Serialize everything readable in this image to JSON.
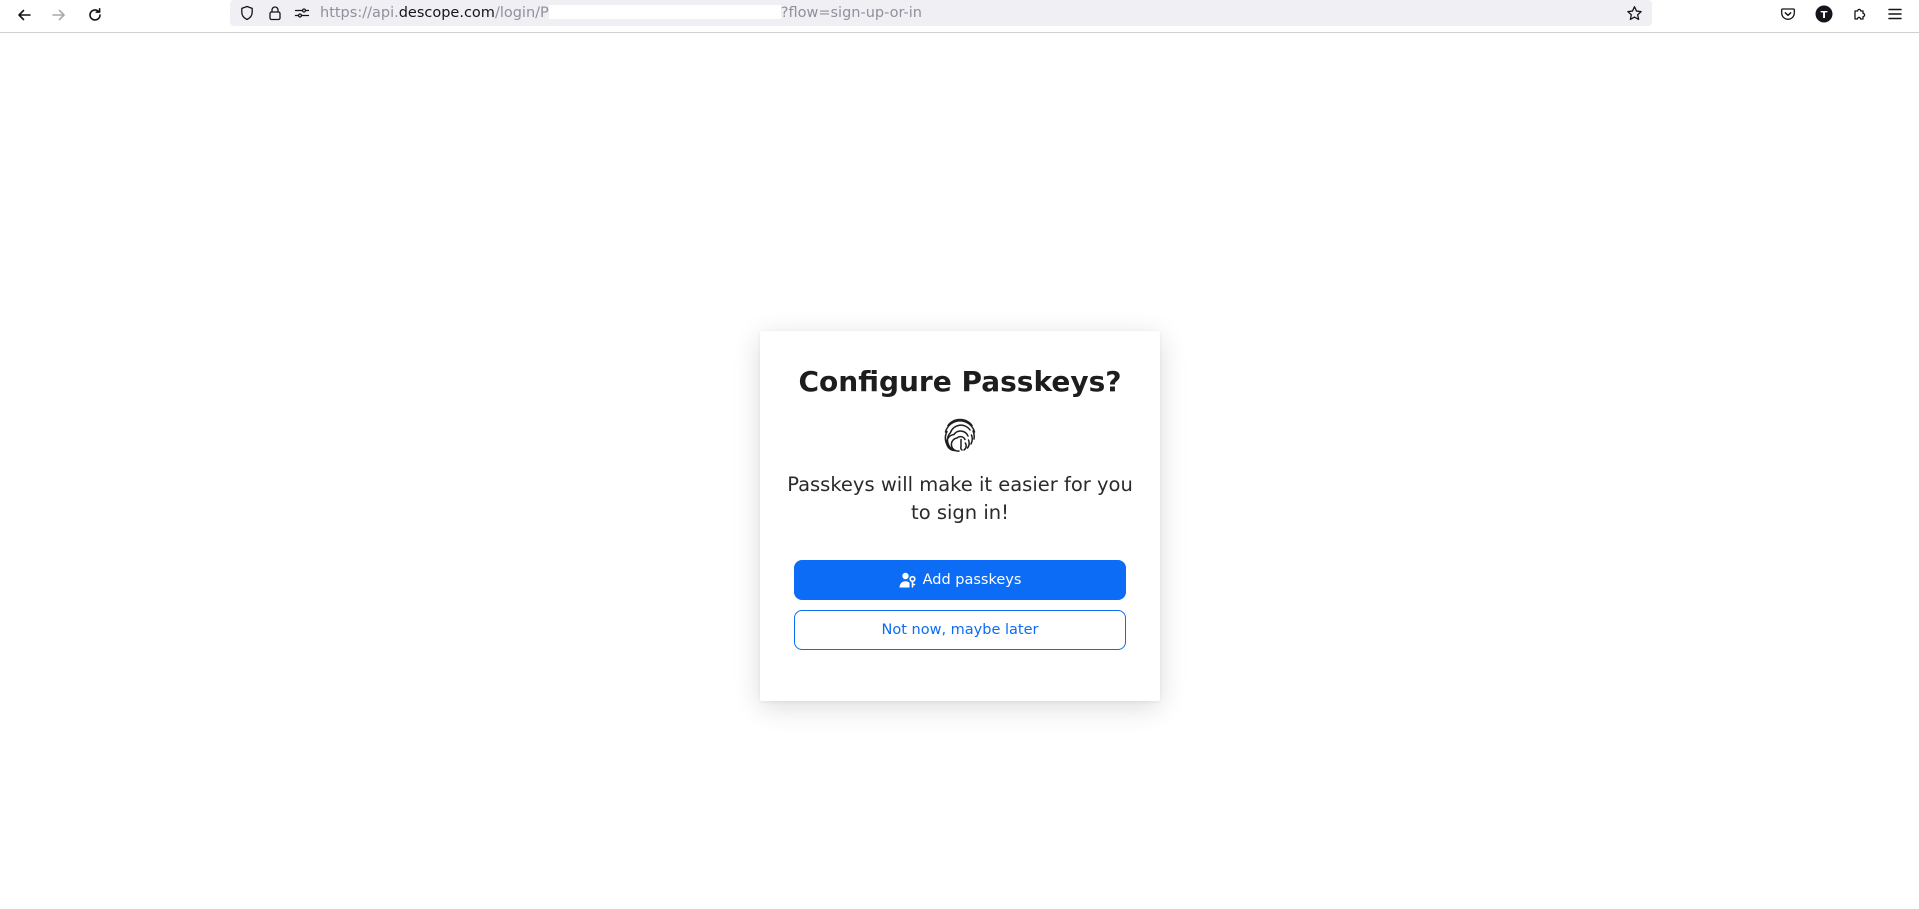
{
  "browser": {
    "url": {
      "prefix": "https://api.",
      "host": "descope.com",
      "path": "/login/P",
      "suffix": "?flow=sign-up-or-in"
    },
    "icons": {
      "back": "back-arrow-icon",
      "forward": "forward-arrow-icon",
      "reload": "reload-icon",
      "tracking": "shield-icon",
      "lock": "lock-icon",
      "permissions": "site-permissions-icon",
      "bookmark": "star-icon",
      "pocket": "pocket-icon",
      "account": "account-avatar-icon",
      "extensions": "extensions-puzzle-icon",
      "menu": "hamburger-menu-icon"
    },
    "account_initial": "T"
  },
  "dialog": {
    "title": "Configure Passkeys?",
    "icon": "fingerprint-icon",
    "description": "Passkeys will make it easier for you to sign in!",
    "primary_button": "Add passkeys",
    "primary_icon": "user-key-icon",
    "secondary_button": "Not now, maybe later"
  },
  "colors": {
    "accent": "#0c6cf5",
    "background": "#ffffff",
    "urlbar": "#f0f0f4"
  }
}
